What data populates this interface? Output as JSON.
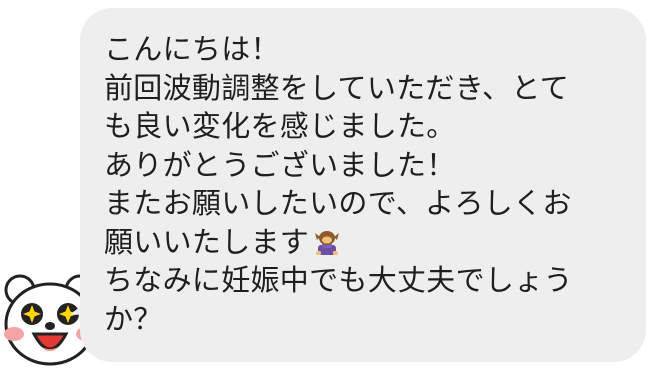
{
  "message": {
    "lines": [
      "こんにちは！",
      "前回波動調整をしていただき、とて",
      "も良い変化を感じました。",
      "ありがとうございました！",
      "またお願いしたいので、よろしくお",
      "願いいたします",
      "ちなみに妊娠中でも大丈夫でしょう",
      "か？"
    ],
    "inline_emoji": "bowing-person-emoji"
  },
  "avatar": {
    "icon": "bear-sticker-avatar"
  },
  "colors": {
    "bubble_bg": "#eeeeef",
    "text": "#1f1f1f",
    "avatar_cheek": "#f4a4a4",
    "avatar_mouth": "#e53935",
    "avatar_star": "#ffd600"
  }
}
